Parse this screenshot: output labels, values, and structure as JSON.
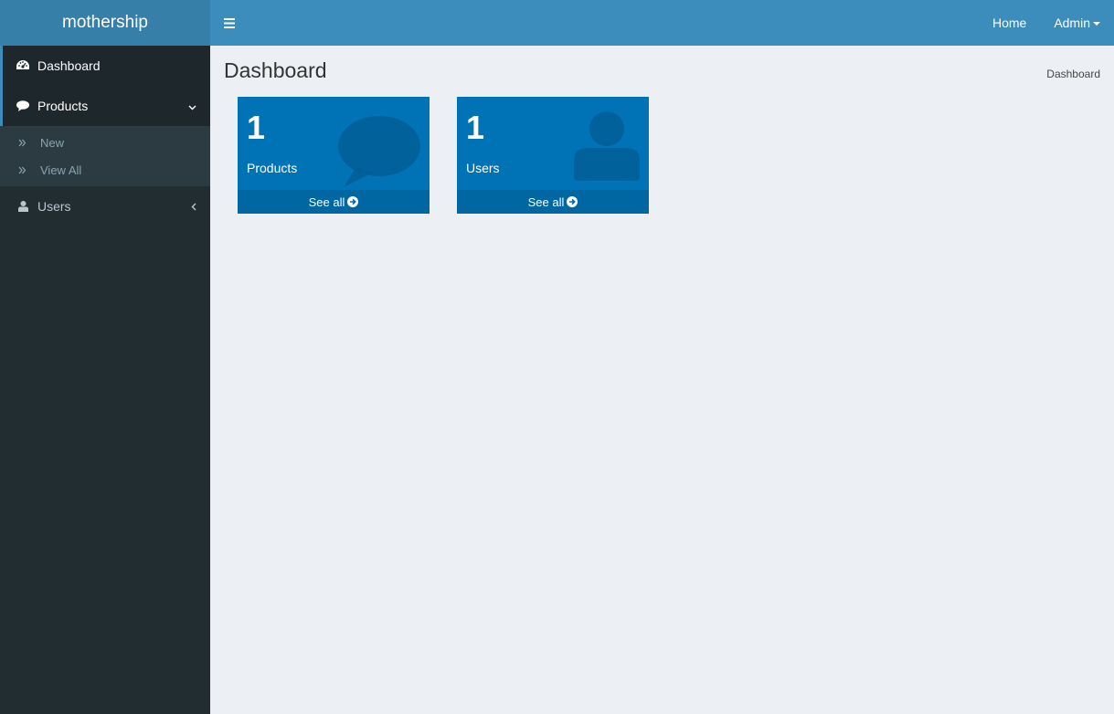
{
  "brand": {
    "name": "mothership"
  },
  "header": {
    "toggle_icon": "hamburger-icon",
    "links": {
      "home": "Home",
      "admin": "Admin"
    }
  },
  "sidebar": {
    "items": [
      {
        "label": "Dashboard",
        "icon": "dashboard-icon"
      },
      {
        "label": "Products",
        "icon": "comment-icon",
        "expanded": true,
        "children": [
          {
            "label": "New",
            "icon": "angle-double-right-icon"
          },
          {
            "label": "View All",
            "icon": "angle-double-right-icon"
          }
        ]
      },
      {
        "label": "Users",
        "icon": "user-icon",
        "expanded": false
      }
    ]
  },
  "main": {
    "title": "Dashboard",
    "breadcrumb": "Dashboard",
    "boxes": [
      {
        "count": "1",
        "label": "Products",
        "link": "See all",
        "icon": "comment-icon",
        "color": "#0073b7"
      },
      {
        "count": "1",
        "label": "Users",
        "link": "See all",
        "icon": "user-icon",
        "color": "#0073b7"
      }
    ]
  },
  "colors": {
    "header": "#3c8dbc",
    "logo_bg": "#367fa9",
    "sidebar": "#222d32",
    "content_bg": "#ecf0f5"
  }
}
